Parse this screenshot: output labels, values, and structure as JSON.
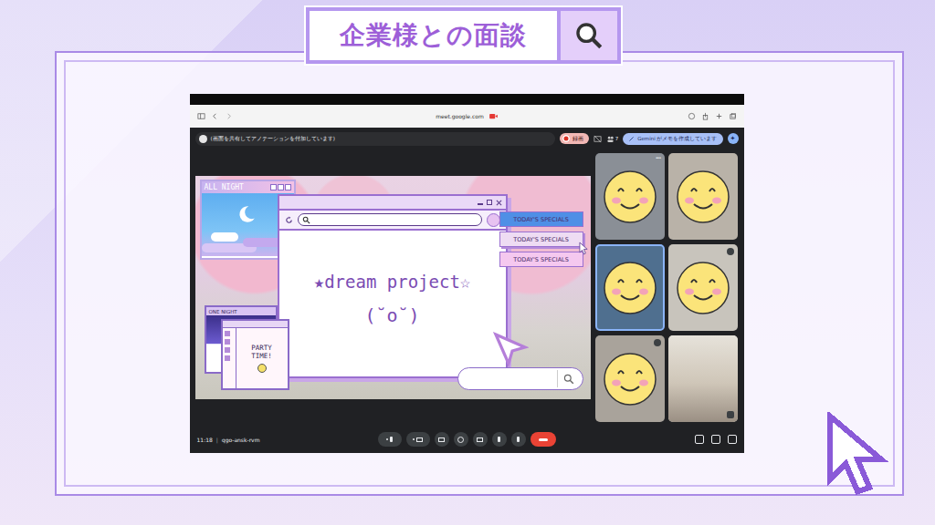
{
  "header": {
    "title": "企業様との面談"
  },
  "browser": {
    "url": "meet.google.com"
  },
  "meet": {
    "banner": "(画面を共有してアノテーションを付加しています)",
    "record_button": "録画",
    "participant_count": "7",
    "gemini": "Gemini がメモを作成しています",
    "time": "11:18",
    "separator": "|",
    "meeting_code": "qgo-ansk-rvm"
  },
  "shared_screen": {
    "mini_window_title": "ALL NIGHT",
    "main_title": "★dream project☆",
    "face": "(˘o˘)",
    "specials": [
      {
        "label": "TODAY'S SPECIALS",
        "selected": false,
        "color": "#4f8fe6"
      },
      {
        "label": "TODAY'S SPECIALS",
        "selected": true,
        "color": "#eedcf3"
      },
      {
        "label": "TODAY'S SPECIALS",
        "selected": false,
        "color": "#f5c8ef"
      }
    ],
    "small_window_title": "ONE NIGHT",
    "party": "PARTY TIME!"
  },
  "participants": [
    {
      "kind": "smiley",
      "speaking": false,
      "muted": false,
      "more": true
    },
    {
      "kind": "smiley",
      "speaking": false,
      "muted": false,
      "more": false
    },
    {
      "kind": "smiley",
      "speaking": true,
      "muted": false,
      "more": false
    },
    {
      "kind": "smiley",
      "speaking": false,
      "muted": true,
      "more": false
    },
    {
      "kind": "smiley",
      "speaking": false,
      "muted": true,
      "more": false
    },
    {
      "kind": "photo",
      "speaking": false,
      "muted": false,
      "more": false
    }
  ]
}
